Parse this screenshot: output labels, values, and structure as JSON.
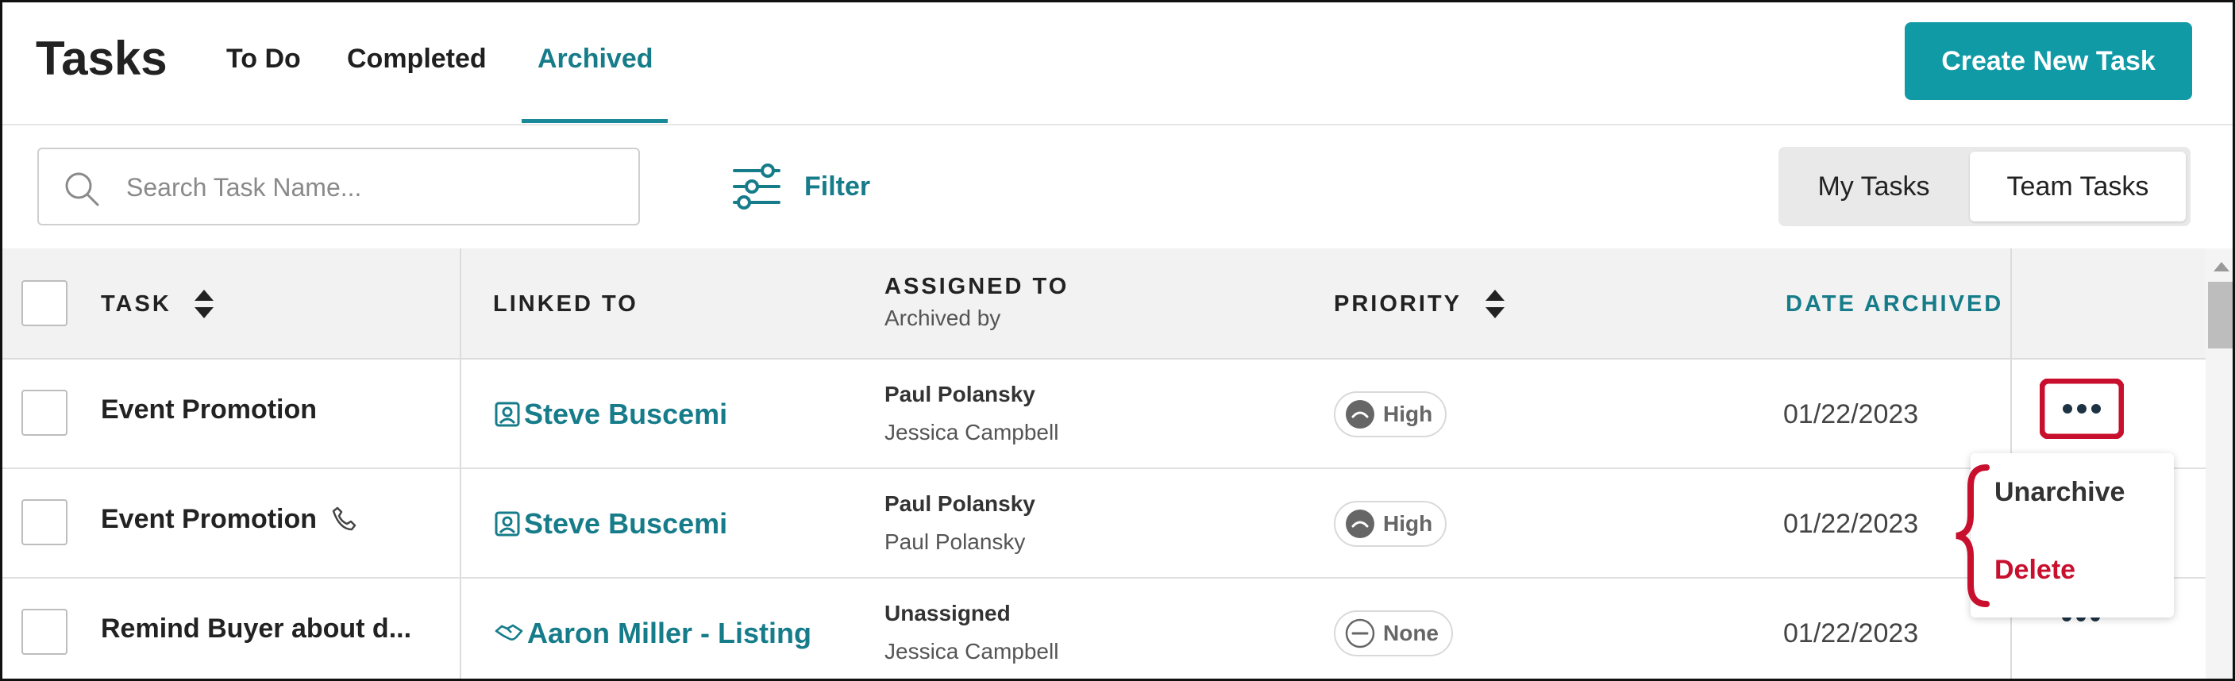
{
  "header": {
    "title": "Tasks",
    "tabs": [
      {
        "label": "To Do"
      },
      {
        "label": "Completed"
      },
      {
        "label": "Archived"
      }
    ],
    "create_button": "Create New Task"
  },
  "toolbar": {
    "search_placeholder": "Search Task Name...",
    "filter_label": "Filter",
    "toggle": {
      "my_tasks": "My Tasks",
      "team_tasks": "Team Tasks",
      "selected": "Team Tasks"
    }
  },
  "table": {
    "columns": {
      "task": "TASK",
      "linked_to": "LINKED TO",
      "assigned_to": "ASSIGNED TO",
      "archived_by": "Archived by",
      "priority": "PRIORITY",
      "date_archived": "DATE ARCHIVED"
    },
    "rows": [
      {
        "task": "Event Promotion",
        "linked_to": "Steve Buscemi",
        "linked_icon": "contact-card-icon",
        "assigned_to": "Paul Polansky",
        "archived_by": "Jessica Campbell",
        "priority": "High",
        "date": "01/22/2023"
      },
      {
        "task": "Event Promotion",
        "linked_to": "Steve Buscemi",
        "linked_icon": "contact-card-icon",
        "assigned_to": "Paul Polansky",
        "archived_by": "Paul Polansky",
        "priority": "High",
        "date": "01/22/2023"
      },
      {
        "task": "Remind Buyer about d...",
        "linked_to": "Aaron Miller - Listing",
        "linked_icon": "handshake-icon",
        "assigned_to": "Unassigned",
        "archived_by": "Jessica Campbell",
        "priority": "None",
        "date": "01/22/2023"
      }
    ]
  },
  "menu": {
    "unarchive": "Unarchive",
    "delete": "Delete"
  },
  "colors": {
    "accent": "#167c8a",
    "button": "#0f9aa6",
    "highlight": "#c8102e",
    "delete": "#c8102e"
  }
}
